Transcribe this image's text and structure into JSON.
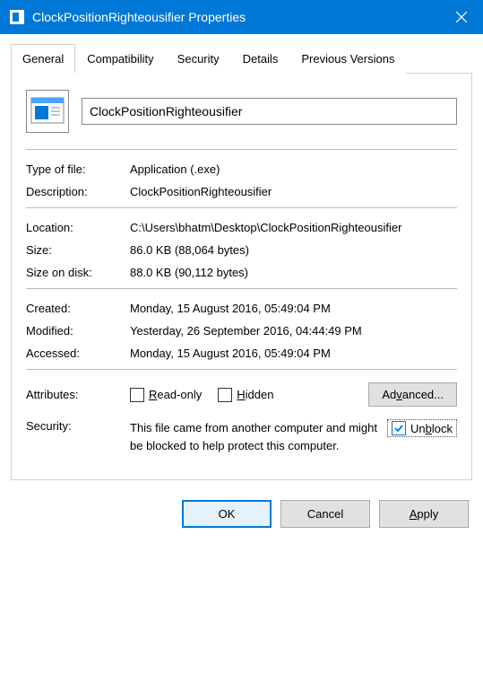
{
  "window": {
    "title": "ClockPositionRighteousifier Properties"
  },
  "tabs": {
    "general": "General",
    "compatibility": "Compatibility",
    "security": "Security",
    "details": "Details",
    "previous": "Previous Versions"
  },
  "file": {
    "name": "ClockPositionRighteousifier",
    "type_label": "Type of file:",
    "type_value": "Application (.exe)",
    "desc_label": "Description:",
    "desc_value": "ClockPositionRighteousifier",
    "loc_label": "Location:",
    "loc_value": "C:\\Users\\bhatm\\Desktop\\ClockPositionRighteousifier",
    "size_label": "Size:",
    "size_value": "86.0 KB (88,064 bytes)",
    "disk_label": "Size on disk:",
    "disk_value": "88.0 KB (90,112 bytes)",
    "created_label": "Created:",
    "created_value": "Monday, 15 August 2016, 05:49:04 PM",
    "modified_label": "Modified:",
    "modified_value": "Yesterday, 26 September 2016, 04:44:49 PM",
    "accessed_label": "Accessed:",
    "accessed_value": "Monday, 15 August 2016, 05:49:04 PM"
  },
  "attributes": {
    "label": "Attributes:",
    "readonly_prefix": "R",
    "readonly_rest": "ead-only",
    "hidden_prefix": "H",
    "hidden_rest": "idden",
    "advanced_prefix": "Ad",
    "advanced_accel": "v",
    "advanced_rest": "anced..."
  },
  "security": {
    "label": "Security:",
    "text": "This file came from another computer and might be blocked to help protect this computer.",
    "unblock_prefix": "Un",
    "unblock_accel": "b",
    "unblock_rest": "lock"
  },
  "buttons": {
    "ok": "OK",
    "cancel": "Cancel",
    "apply_accel": "A",
    "apply_rest": "pply"
  }
}
